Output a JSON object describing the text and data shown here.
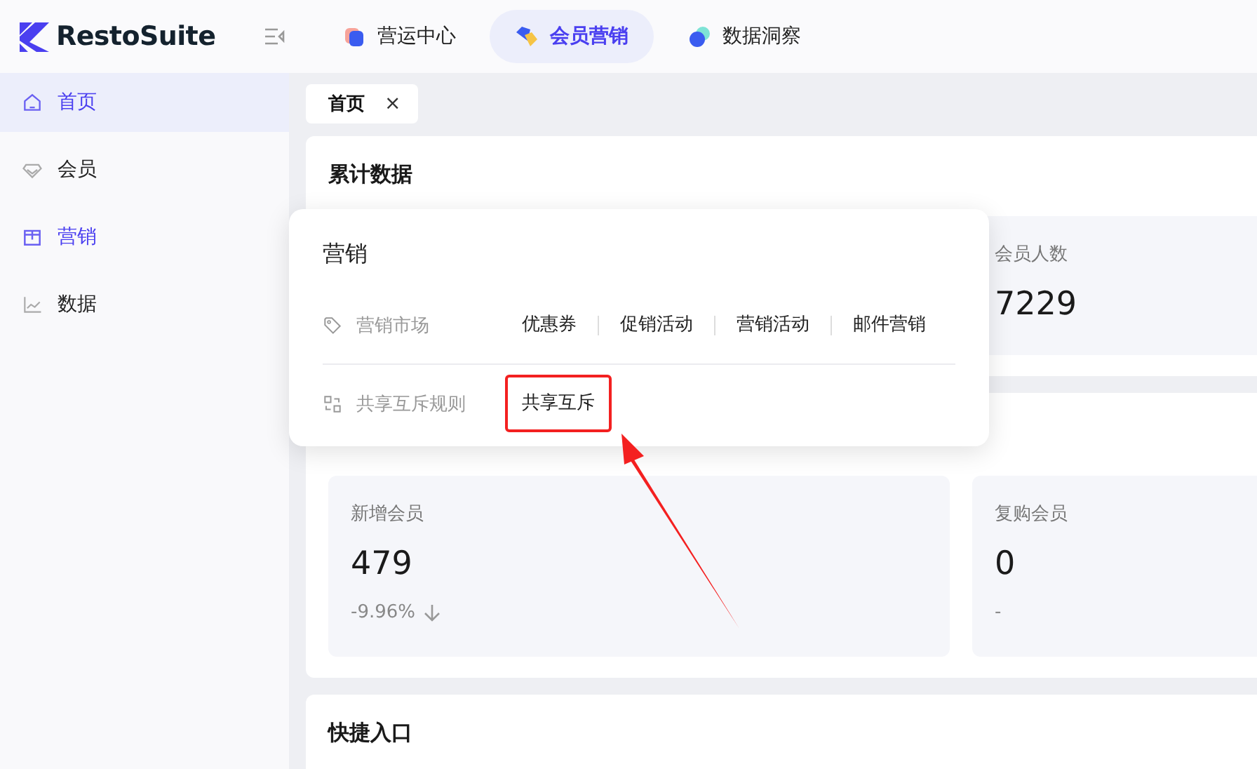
{
  "header": {
    "brand": "RestoSuite",
    "nav": [
      {
        "label": "营运中心",
        "selected": false,
        "kind": "ops"
      },
      {
        "label": "会员营销",
        "selected": true,
        "kind": "member"
      },
      {
        "label": "数据洞察",
        "selected": false,
        "kind": "data"
      }
    ]
  },
  "sidebar": {
    "items": [
      {
        "label": "首页",
        "selected": true,
        "open": false,
        "kind": "home"
      },
      {
        "label": "会员",
        "selected": false,
        "open": false,
        "kind": "member"
      },
      {
        "label": "营销",
        "selected": false,
        "open": true,
        "kind": "marketing"
      },
      {
        "label": "数据",
        "selected": false,
        "open": false,
        "kind": "chart"
      }
    ]
  },
  "tabs": [
    {
      "label": "首页",
      "close": "×",
      "selected": true
    }
  ],
  "cumulative": {
    "title": "累计数据",
    "metrics": [
      {
        "label": "会员人数",
        "value": "7229"
      }
    ]
  },
  "members": {
    "metrics": [
      {
        "label": "新增会员",
        "value": "479",
        "change": "-9.96%",
        "kind": "down"
      },
      {
        "label": "复购会员",
        "value": "0",
        "change": "-",
        "kind": "plain"
      }
    ]
  },
  "shortcuts": {
    "title": "快捷入口"
  },
  "popover": {
    "title": "营销",
    "groups": [
      {
        "label": "营销市场",
        "kind": "tag",
        "links": [
          {
            "label": "优惠券",
            "highlighted": false
          },
          {
            "label": "促销活动",
            "highlighted": false
          },
          {
            "label": "营销活动",
            "highlighted": false
          },
          {
            "label": "邮件营销",
            "highlighted": false
          }
        ]
      },
      {
        "label": "共享互斥规则",
        "kind": "share",
        "links": [
          {
            "label": "共享互斥",
            "highlighted": true
          }
        ]
      }
    ]
  },
  "annotation": {
    "kind": "arrow"
  }
}
